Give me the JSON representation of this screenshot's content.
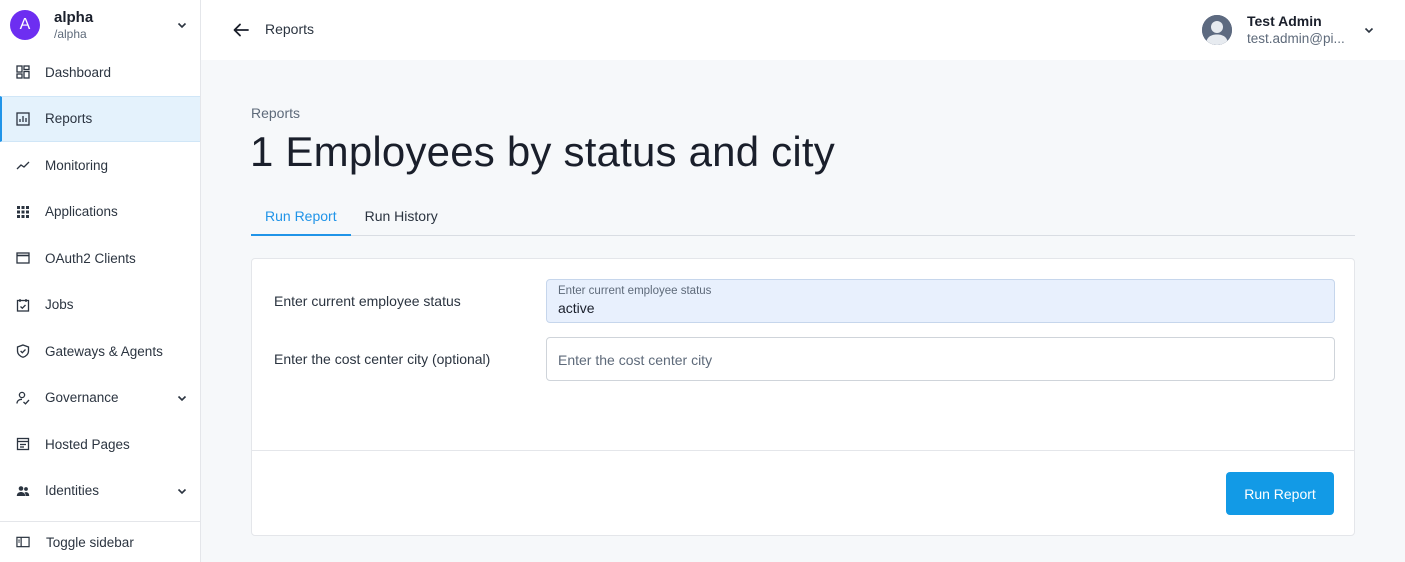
{
  "realm": {
    "initial": "A",
    "name": "alpha",
    "path": "/alpha"
  },
  "sidebar": {
    "items": [
      {
        "label": "Dashboard",
        "icon": "dashboard-icon"
      },
      {
        "label": "Reports",
        "icon": "reports-icon",
        "active": true
      },
      {
        "label": "Monitoring",
        "icon": "monitoring-icon"
      },
      {
        "label": "Applications",
        "icon": "apps-grid-icon"
      },
      {
        "label": "OAuth2 Clients",
        "icon": "window-icon"
      },
      {
        "label": "Jobs",
        "icon": "calendar-check-icon"
      },
      {
        "label": "Gateways & Agents",
        "icon": "shield-icon"
      },
      {
        "label": "Governance",
        "icon": "governance-icon",
        "expandable": true
      },
      {
        "label": "Hosted Pages",
        "icon": "page-icon"
      },
      {
        "label": "Identities",
        "icon": "people-icon",
        "expandable": true
      }
    ],
    "toggle_label": "Toggle sidebar"
  },
  "topbar": {
    "breadcrumb": "Reports"
  },
  "user": {
    "name": "Test Admin",
    "email": "test.admin@pi..."
  },
  "page": {
    "subtitle": "Reports",
    "title": "1 Employees by status and city",
    "tabs": [
      "Run Report",
      "Run History"
    ]
  },
  "form": {
    "status": {
      "label": "Enter current employee status",
      "float_label": "Enter current employee status",
      "value": "active"
    },
    "city": {
      "label": "Enter the cost center city (optional)",
      "placeholder": "Enter the cost center city"
    },
    "run_button": "Run Report"
  },
  "colors": {
    "accent": "#2094e8",
    "button": "#129ae6",
    "realm_avatar": "#6d2ef1"
  }
}
